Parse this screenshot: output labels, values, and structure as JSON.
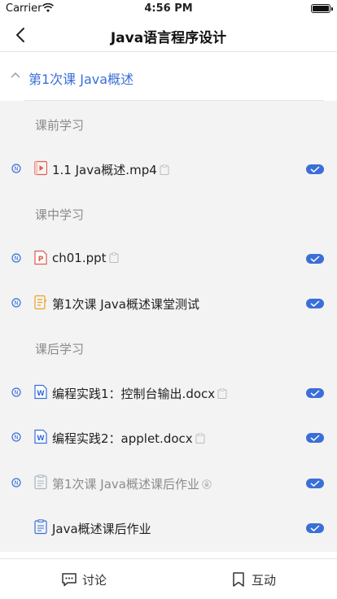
{
  "status_bar": {
    "carrier": "Carrier",
    "time": "4:56 PM"
  },
  "nav": {
    "title": "Java语言程序设计"
  },
  "chapter": {
    "title": "第1次课  Java概述"
  },
  "sections": [
    {
      "label": "课前学习"
    },
    {
      "label": "课中学习"
    },
    {
      "label": "课后学习"
    }
  ],
  "items": [
    {
      "label": "1.1 Java概述.mp4",
      "type": "video"
    },
    {
      "label": "ch01.ppt",
      "type": "ppt"
    },
    {
      "label": "第1次课 Java概述课堂测试",
      "type": "quiz"
    },
    {
      "label": "编程实践1：控制台输出.docx",
      "type": "word"
    },
    {
      "label": "编程实践2：applet.docx",
      "type": "word"
    },
    {
      "label": "第1次课 Java概述课后作业",
      "type": "homework"
    },
    {
      "label": "Java概述课后作业",
      "type": "homework"
    }
  ],
  "tabs": {
    "discuss": "讨论",
    "interact": "互动"
  },
  "colors": {
    "accent": "#3a6fd8",
    "content_bg": "#f3f3f3"
  }
}
